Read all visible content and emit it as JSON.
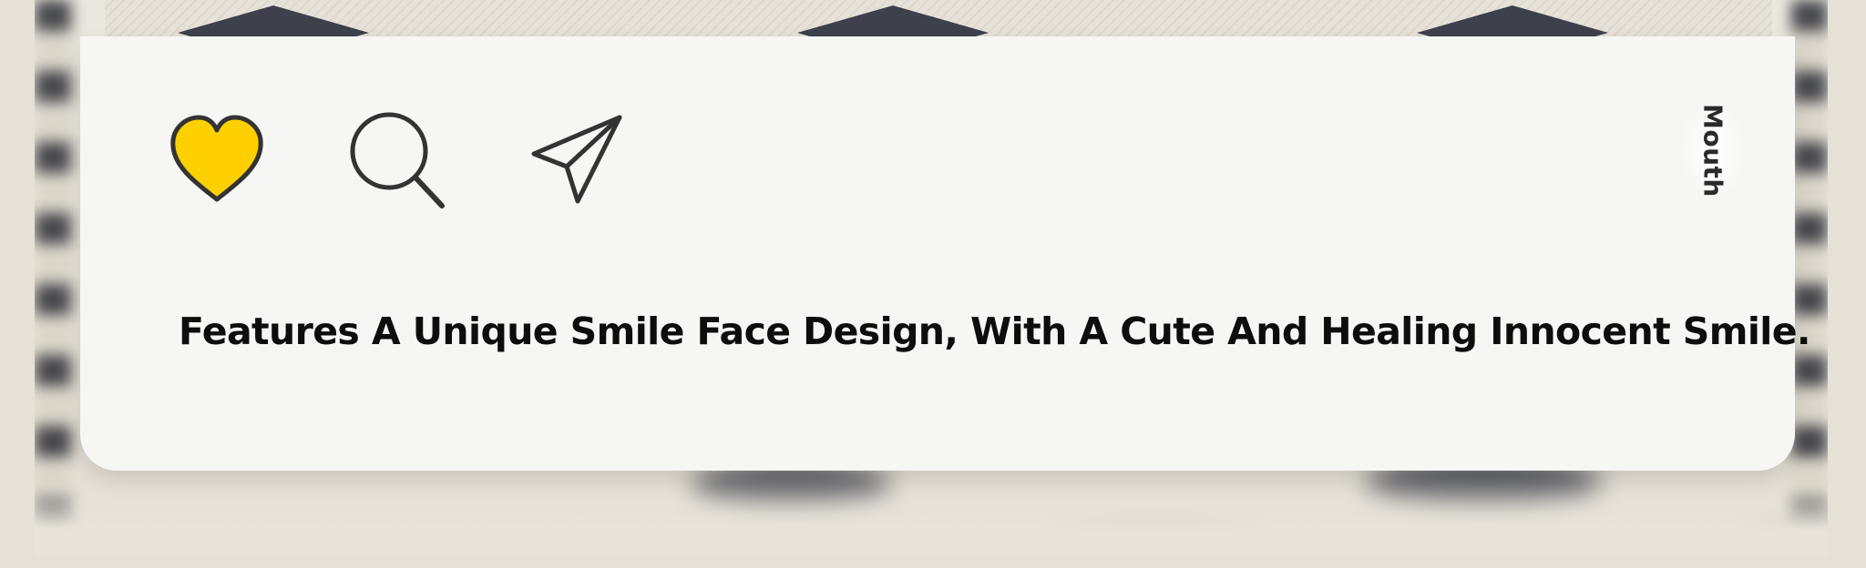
{
  "colors": {
    "card_background": "#f6f6f5",
    "heart_fill": "#ffd000",
    "icon_stroke": "#333333",
    "caption_text": "#0d0d0d",
    "backdrop": "#e6e1d7"
  },
  "actions": [
    {
      "name": "like",
      "icon": "heart-icon",
      "active": true
    },
    {
      "name": "search",
      "icon": "search-icon",
      "active": false
    },
    {
      "name": "share",
      "icon": "send-icon",
      "active": false
    }
  ],
  "side_tab": {
    "label": "Mouth"
  },
  "post": {
    "caption": "Features A Unique Smile Face Design, With A Cute And Healing Innocent Smile."
  }
}
